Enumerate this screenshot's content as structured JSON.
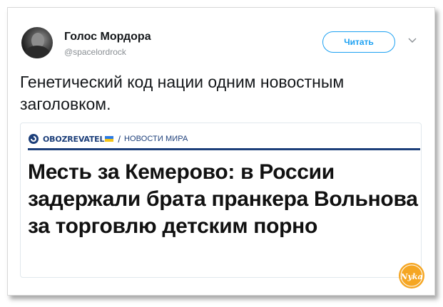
{
  "tweet": {
    "display_name": "Голос Мордора",
    "username": "@spacelordrock",
    "follow_label": "Читать",
    "text": "Генетический код нации одним новостным заголовком."
  },
  "card": {
    "source_logo": "OBOZREVATEL",
    "separator": "/",
    "section": "НОВОСТИ МИРА",
    "headline": "Месть за Кемерово: в России задержали брата пранкера Вольнова за торговлю детским порно"
  },
  "watermark": {
    "text": "Nyka"
  },
  "colors": {
    "follow_accent": "#1da1f2",
    "source_brand": "#1d3f7a",
    "watermark": "#f5a623"
  },
  "icons": {
    "menu": "chevron-down-icon",
    "logo": "obozrevatel-logo-icon",
    "flag": "ukraine-flag-icon"
  }
}
